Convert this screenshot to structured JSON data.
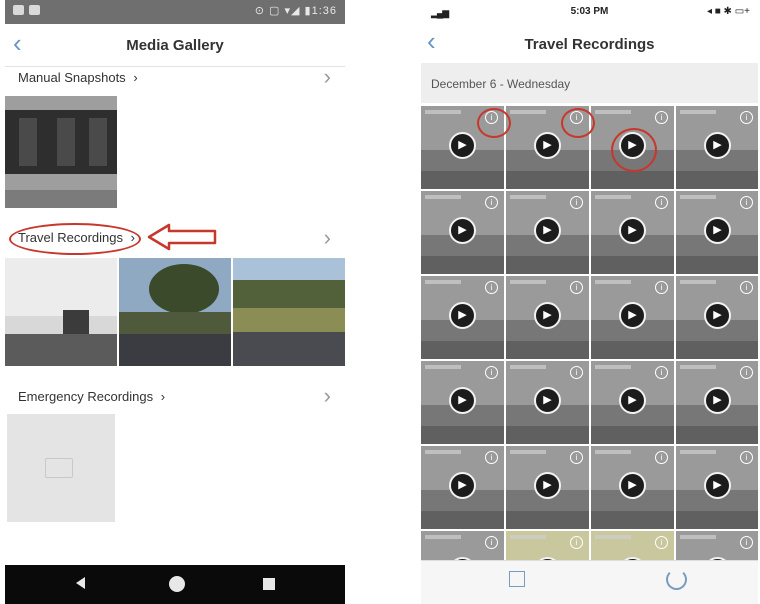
{
  "colors": {
    "accent": "#6a94c8",
    "annotation_red": "#c7372c",
    "status_bar": "#6f6f6f",
    "nav_bar": "#0a0a0a",
    "section_header_bg": "#eeeeee"
  },
  "left_screen": {
    "status": {
      "right_text": "⊙ ▢ ▾◢ ▮1:36"
    },
    "nav": {
      "back_icon": "chevron-left-icon",
      "title": "Media Gallery"
    },
    "sections": [
      {
        "title": "Manual Snapshots",
        "arrow": "›",
        "chevron": "›",
        "highlighted": false
      },
      {
        "title": "Travel Recordings",
        "arrow": "›",
        "chevron": "›",
        "highlighted": true
      },
      {
        "title": "Emergency Recordings",
        "arrow": "›",
        "chevron": "›",
        "highlighted": false
      }
    ],
    "system_nav": [
      "back-icon",
      "home-icon",
      "recents-icon"
    ]
  },
  "right_screen": {
    "status": {
      "signal": "▂▄▆",
      "time": "5:03 PM",
      "battery": "◂ ■ ✱ ▭+"
    },
    "nav": {
      "back_icon": "chevron-left-icon",
      "title": "Travel Recordings"
    },
    "date_header": "December 6 - Wednesday",
    "grid": {
      "rows": 6,
      "columns": 4,
      "play_icon": "▶",
      "info_icon": "i"
    },
    "tab_bar": [
      "share-icon",
      "refresh-icon"
    ]
  }
}
